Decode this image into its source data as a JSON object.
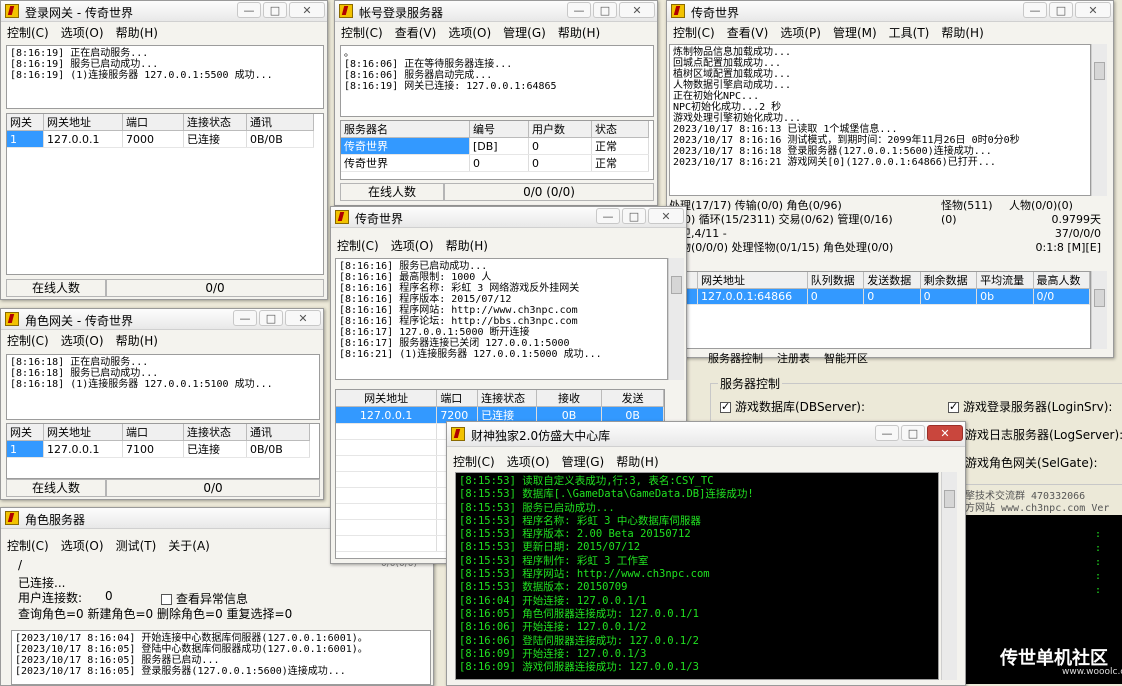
{
  "w1": {
    "title": "登录网关 - 传奇世界",
    "menu": [
      "控制(C)",
      "选项(O)",
      "帮助(H)"
    ],
    "log": "[8:16:19] 正在启动服务...\n[8:16:19] 服务已启动成功...\n[8:16:19] (1)连接服务器 127.0.0.1:5500 成功...",
    "cols": [
      "网关",
      "网关地址",
      "端口",
      "连接状态",
      "通讯"
    ],
    "row": [
      "1",
      "127.0.0.1",
      "7000",
      "已连接",
      "0B/0B"
    ],
    "status": [
      "在线人数",
      "0/0"
    ]
  },
  "w2": {
    "title": "帐号登录服务器",
    "menu": [
      "控制(C)",
      "查看(V)",
      "选项(O)",
      "管理(G)",
      "帮助(H)"
    ],
    "log": "。\n[8:16:06] 正在等待服务器连接...\n[8:16:06] 服务器启动完成...\n[8:16:19] 网关已连接: 127.0.0.1:64865",
    "cols": [
      "服务器名",
      "编号",
      "用户数",
      "状态"
    ],
    "rows": [
      [
        "传奇世界",
        "[DB]",
        "0",
        "正常"
      ],
      [
        "传奇世界",
        "0",
        "0",
        "正常"
      ]
    ],
    "status": [
      "在线人数",
      "0/0 (0/0)"
    ]
  },
  "w3": {
    "title": "传奇世界",
    "menu": [
      "控制(C)",
      "查看(V)",
      "选项(P)",
      "管理(M)",
      "工具(T)",
      "帮助(H)"
    ],
    "log": "炼制物品信息加载成功...\n回城点配置加载成功...\n植树区域配置加载成功...\n人物数据引擎启动成功...\n正在初始化NPC...\nNPC初始化成功...2 秒\n游戏处理引擎初始化成功...\n2023/10/17 8:16:13 已读取 1个城堡信息...\n2023/10/17 8:16:16 测试模式，到期时间：2099年11月26日 0时0分0秒\n2023/10/17 8:16:18 登录服务器(127.0.0.1:5600)连接成功...\n2023/10/17 8:16:21 游戏网关[0](127.0.0.1:64866)已打开...",
    "stats": [
      "处理(17/17) 传输(0/0) 角色(0/96)",
      "怪物(511)",
      "人物(0/0)(0)",
      "(0/0) 循环(15/2311) 交易(0/62) 管理(0/16)",
      "(0)",
      "0.9799天",
      "警卫,4/11 -",
      "37/0/0/0",
      "怪物(0/0/0) 处理怪物(0/1/15) 角色处理(0/0)",
      "0:1:8 [M][E]"
    ],
    "cols": [
      "关",
      "网关地址",
      "队列数据",
      "发送数据",
      "剩余数据",
      "平均流量",
      "最高人数"
    ],
    "row": [
      "",
      "127.0.0.1:64866",
      "0",
      "0",
      "0",
      "0b",
      "0/0"
    ],
    "tabs": [
      "服务器控制",
      "注册表",
      "智能开区"
    ],
    "ctrl_title": "服务器控制",
    "checks": [
      [
        "游戏数据库(DBServer):",
        true
      ],
      [
        "游戏登录服务器(LoginSrv):",
        true
      ]
    ],
    "right_labels": [
      "游戏日志服务器(LogServer):",
      "游戏角色网关(SelGate):"
    ],
    "qq": "擎技术交流群 470332066",
    "site": "方网站 www.ch3npc.com Ver"
  },
  "w4": {
    "title": "角色网关 - 传奇世界",
    "menu": [
      "控制(C)",
      "选项(O)",
      "帮助(H)"
    ],
    "log": "[8:16:18] 正在启动服务...\n[8:16:18] 服务已启动成功...\n[8:16:18] (1)连接服务器 127.0.0.1:5100 成功...",
    "cols": [
      "网关",
      "网关地址",
      "端口",
      "连接状态",
      "通讯"
    ],
    "row": [
      "1",
      "127.0.0.1",
      "7100",
      "已连接",
      "0B/0B"
    ],
    "status": [
      "在线人数",
      "0/0"
    ]
  },
  "w5": {
    "title": "传奇世界",
    "menu": [
      "控制(C)",
      "选项(O)",
      "帮助(H)"
    ],
    "log": "[8:16:16] 服务已启动成功...\n[8:16:16] 最高限制: 1000 人\n[8:16:16] 程序名称: 彩虹 3 网络游戏反外挂网关\n[8:16:16] 程序版本: 2015/07/12\n[8:16:16] 程序网站: http://www.ch3npc.com\n[8:16:16] 程序论坛: http://bbs.ch3npc.com\n[8:16:17] 127.0.0.1:5000 断开连接\n[8:16:17] 服务器连接已关闭 127.0.0.1:5000\n[8:16:21] (1)连接服务器 127.0.0.1:5000 成功...",
    "cols": [
      "网关地址",
      "端口",
      "连接状态",
      "接收",
      "发送"
    ],
    "row": [
      "127.0.0.1",
      "7200",
      "已连接",
      "0B",
      "0B"
    ]
  },
  "w6": {
    "title": "角色服务器",
    "menu": [
      "控制(C)",
      "选项(O)",
      "测试(T)",
      "关于(A)"
    ],
    "top": "0/0(0/0)",
    "slash": "/",
    "conn": "已连接...",
    "users_label": "用户连接数:",
    "users_val": "0",
    "check_label": "查看异常信息",
    "counts": "查询角色=0   新建角色=0   删除角色=0   重复选择=0",
    "log": "[2023/10/17 8:16:04] 开始连接中心数据库伺服器(127.0.0.1:6001)。\n[2023/10/17 8:16:05] 登陆中心数据库伺服器成功(127.0.0.1:6001)。\n[2023/10/17 8:16:05] 服务器已启动...\n[2023/10/17 8:16:05] 登录服务器(127.0.0.1:5600)连接成功..."
  },
  "w7": {
    "title": "财神独家2.0仿盛大中心库",
    "menu": [
      "控制(C)",
      "选项(O)",
      "管理(G)",
      "帮助(H)"
    ],
    "log": "[8:15:53] 读取自定义表成功,行:3, 表名:CSY_TC\n[8:15:53] 数据库[.\\GameData\\GameData.DB]连接成功!\n[8:15:53] 服务已启动成功...\n[8:15:53] 程序名称: 彩虹 3 中心数据库伺服器\n[8:15:53] 程序版本: 2.00 Beta 20150712\n[8:15:53] 更新日期: 2015/07/12\n[8:15:53] 程序制作: 彩虹 3 工作室\n[8:15:53] 程序网站: http://www.ch3npc.com\n[8:15:53] 数据版本: 20150709\n[8:16:04] 开始连接: 127.0.0.1/1\n[8:16:05] 角色伺服器连接成功: 127.0.0.1/1\n[8:16:06] 开始连接: 127.0.0.1/2\n[8:16:06] 登陆伺服器连接成功: 127.0.0.1/2\n[8:16:09] 开始连接: 127.0.0.1/3\n[8:16:09] 游戏伺服器连接成功: 127.0.0.1/3"
  },
  "watermark": {
    "main": "传世单机社区",
    "sub": "www.wooolc.com"
  }
}
